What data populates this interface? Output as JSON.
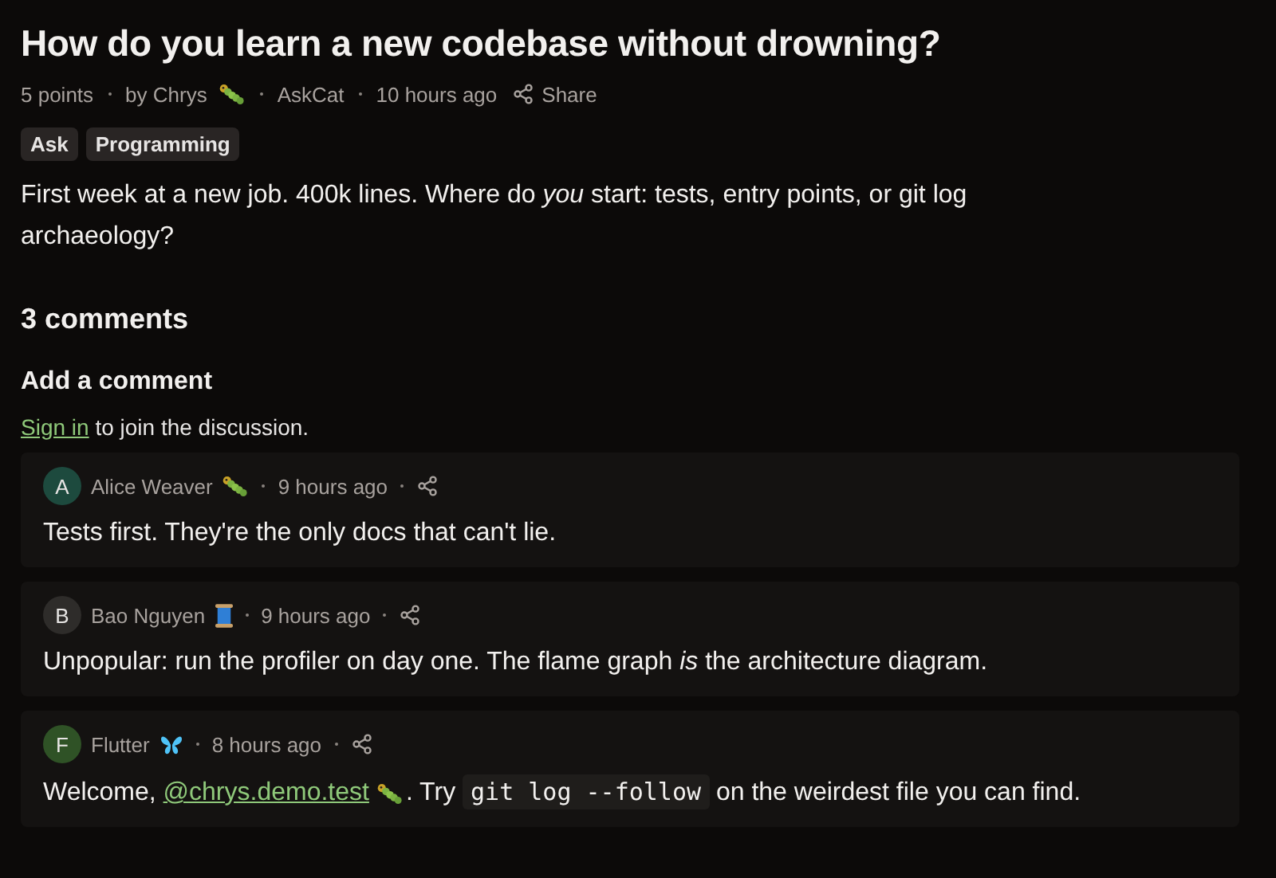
{
  "post": {
    "title": "How do you learn a new codebase without drowning?",
    "meta": {
      "points": "5 points",
      "author": "by Chrys",
      "author_flair": {
        "kind": "caterpillar"
      },
      "category": "AskCat",
      "time": "10 hours ago",
      "share": "Share"
    },
    "tags": [
      "Ask",
      "Programming"
    ],
    "body": "First week at a new job. 400k lines. Where do *you* start: tests, entry points, or git log archaeology?"
  },
  "comments_heading": "3 comments",
  "add_comment": {
    "heading": "Add a comment",
    "sign_in_link": "Sign in",
    "sign_in_text": " to join the discussion."
  },
  "comments": [
    {
      "initial": "A",
      "color": "#1d4a3e",
      "author": "Alice Weaver",
      "flair": {
        "kind": "caterpillar"
      },
      "time": "9 hours ago",
      "body": [
        {
          "kind": "text",
          "text": "Tests first. They're the only docs that can't lie."
        }
      ]
    },
    {
      "initial": "B",
      "color": "#2e2c2a",
      "author": "Bao Nguyen",
      "flair": {
        "kind": "spool"
      },
      "time": "9 hours ago",
      "body": [
        {
          "kind": "text",
          "text": "Unpopular: run the profiler on day one. The flame graph *is* the architecture diagram."
        }
      ]
    },
    {
      "initial": "F",
      "color": "#2f5226",
      "author": "Flutter",
      "flair": {
        "kind": "butterfly"
      },
      "time": "8 hours ago",
      "body": [
        {
          "kind": "text",
          "text": "Welcome, "
        },
        {
          "kind": "mention",
          "text": "@chrys.demo.test"
        },
        {
          "kind": "flair",
          "flair": {
            "kind": "caterpillar"
          }
        },
        {
          "kind": "text",
          "text": ". Try "
        },
        {
          "kind": "code",
          "text": "git log --follow"
        },
        {
          "kind": "text",
          "text": " on the weirdest file you can find."
        }
      ]
    }
  ]
}
